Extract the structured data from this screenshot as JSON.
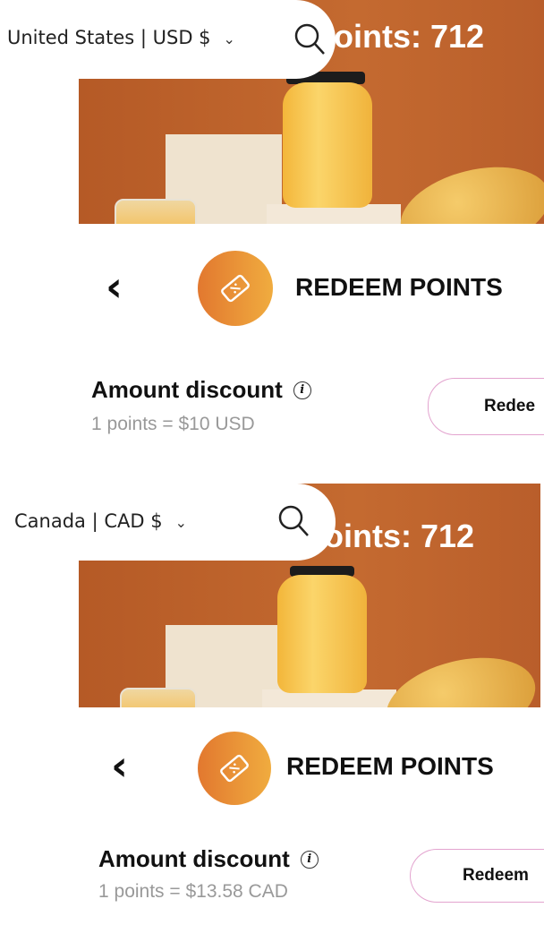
{
  "panels": [
    {
      "location": "United States | USD $",
      "points_label": "oints: 712",
      "title": "REDEEM POINTS",
      "discount_title": "Amount discount",
      "rate": "1 points = $10 USD",
      "button": "Redee"
    },
    {
      "location": "Canada | CAD $",
      "points_label": "oints: 712",
      "title": "REDEEM POINTS",
      "discount_title": "Amount discount",
      "rate": "1 points = $13.58 CAD",
      "button": "Redeem"
    }
  ],
  "icons": {
    "search": "search-icon",
    "dropdown": "chevron-down-icon",
    "back": "chevron-left-icon",
    "badge": "ticket-icon",
    "info": "info-icon"
  },
  "colors": {
    "badge_start": "#e2782f",
    "badge_end": "#f0ac3f",
    "hero": "#b9602a",
    "button_border": "#e3a4cf"
  }
}
